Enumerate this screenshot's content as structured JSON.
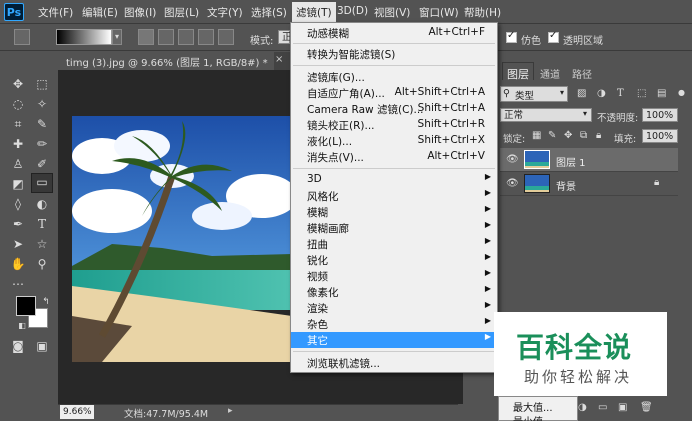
{
  "menubar": {
    "items": [
      "文件(F)",
      "编辑(E)",
      "图像(I)",
      "图层(L)",
      "文字(Y)",
      "选择(S)",
      "滤镜(T)",
      "3D(D)",
      "视图(V)",
      "窗口(W)",
      "帮助(H)"
    ],
    "active": "滤镜(T)"
  },
  "options_bar": {
    "mode_label": "模式:",
    "mode_value": "正",
    "dither_label": "仿色",
    "transparency_label": "透明区域"
  },
  "document": {
    "tab_title": "timg (3).jpg @ 9.66% (图层 1, RGB/8#) *",
    "zoom": "9.66%",
    "doc_info": "文档:47.7M/95.4M"
  },
  "filter_menu": {
    "top": [
      {
        "label": "动感模糊",
        "shortcut": "Alt+Ctrl+F"
      },
      {
        "label": "转换为智能滤镜(S)",
        "shortcut": ""
      }
    ],
    "mid": [
      {
        "label": "滤镜库(G)...",
        "shortcut": ""
      },
      {
        "label": "自适应广角(A)...",
        "shortcut": "Alt+Shift+Ctrl+A"
      },
      {
        "label": "Camera Raw 滤镜(C)...",
        "shortcut": "Shift+Ctrl+A"
      },
      {
        "label": "镜头校正(R)...",
        "shortcut": "Shift+Ctrl+R"
      },
      {
        "label": "液化(L)...",
        "shortcut": "Shift+Ctrl+X"
      },
      {
        "label": "消失点(V)...",
        "shortcut": "Alt+Ctrl+V"
      }
    ],
    "sub": [
      "3D",
      "风格化",
      "模糊",
      "模糊画廊",
      "扭曲",
      "锐化",
      "视频",
      "像素化",
      "渲染",
      "杂色",
      "其它"
    ],
    "highlighted": "其它",
    "bottom": "浏览联机滤镜..."
  },
  "submenu": {
    "items": [
      "最大值...",
      "最小值..."
    ]
  },
  "layers_panel": {
    "tabs": [
      "图层",
      "通道",
      "路径"
    ],
    "kind_label": "类型",
    "blend_mode": "正常",
    "opacity_label": "不透明度:",
    "opacity_value": "100%",
    "lock_label": "锁定:",
    "fill_label": "填充:",
    "fill_value": "100%",
    "layers": [
      {
        "name": "图层 1",
        "selected": true
      },
      {
        "name": "背景",
        "selected": false
      }
    ]
  },
  "watermark": {
    "main": "百科全说",
    "sub": "助你轻松解决"
  },
  "colors": {
    "menu_highlight": "#3399ff",
    "ui_bg": "#535353",
    "watermark_green": "#1a8f5a"
  }
}
